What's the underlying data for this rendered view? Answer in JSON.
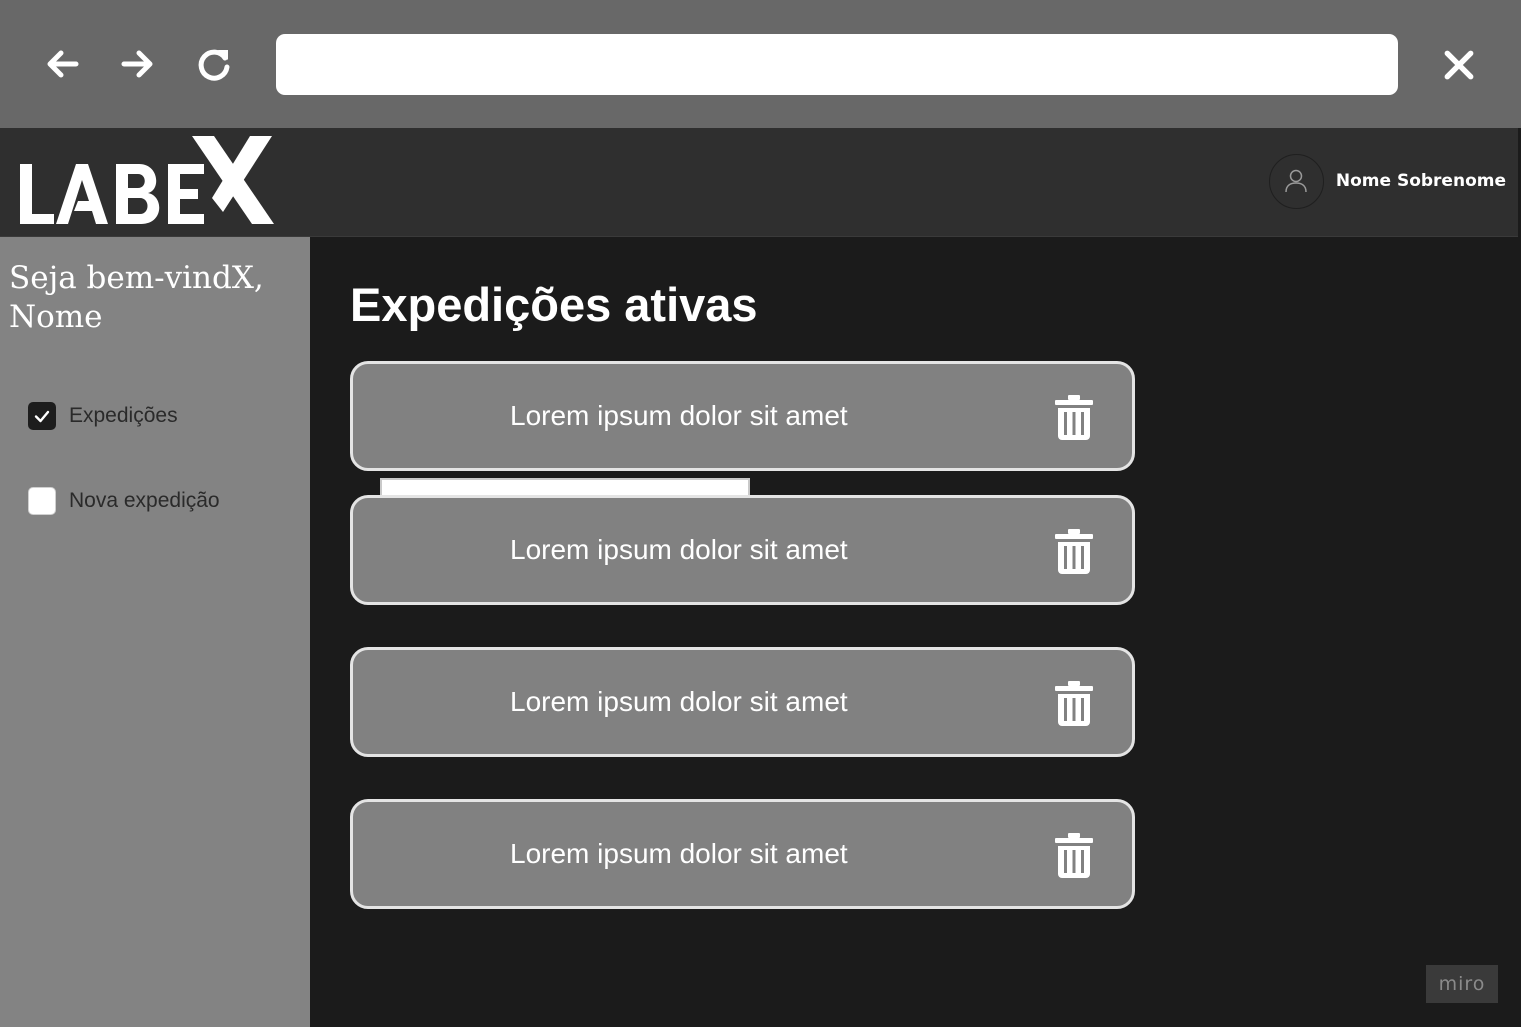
{
  "browser": {
    "back_icon": "arrow-left-icon",
    "forward_icon": "arrow-right-icon",
    "reload_icon": "reload-icon",
    "close_icon": "close-icon",
    "address_value": ""
  },
  "header": {
    "logo_text": "LABEX",
    "user_name": "Nome Sobrenome",
    "avatar_icon": "user-icon"
  },
  "sidebar": {
    "welcome_line1": "Seja bem-vindX,",
    "welcome_line2": "Nome",
    "items": [
      {
        "label": "Expedições",
        "checked": true
      },
      {
        "label": "Nova expedição",
        "checked": false
      }
    ]
  },
  "main": {
    "title": "Expedições ativas",
    "cards": [
      {
        "label": "Lorem ipsum dolor sit amet",
        "action_icon": "trash-icon"
      },
      {
        "label": "Lorem ipsum dolor sit amet",
        "action_icon": "trash-icon"
      },
      {
        "label": "Lorem ipsum dolor sit amet",
        "action_icon": "trash-icon"
      },
      {
        "label": "Lorem ipsum dolor sit amet",
        "action_icon": "trash-icon"
      }
    ]
  },
  "watermark": "miro",
  "colors": {
    "browser_chrome": "#686868",
    "header_bg": "#2f2f2f",
    "sidebar_bg": "#838383",
    "main_bg": "#1b1b1b",
    "card_bg": "#818181",
    "card_border": "#e4e4e4"
  }
}
